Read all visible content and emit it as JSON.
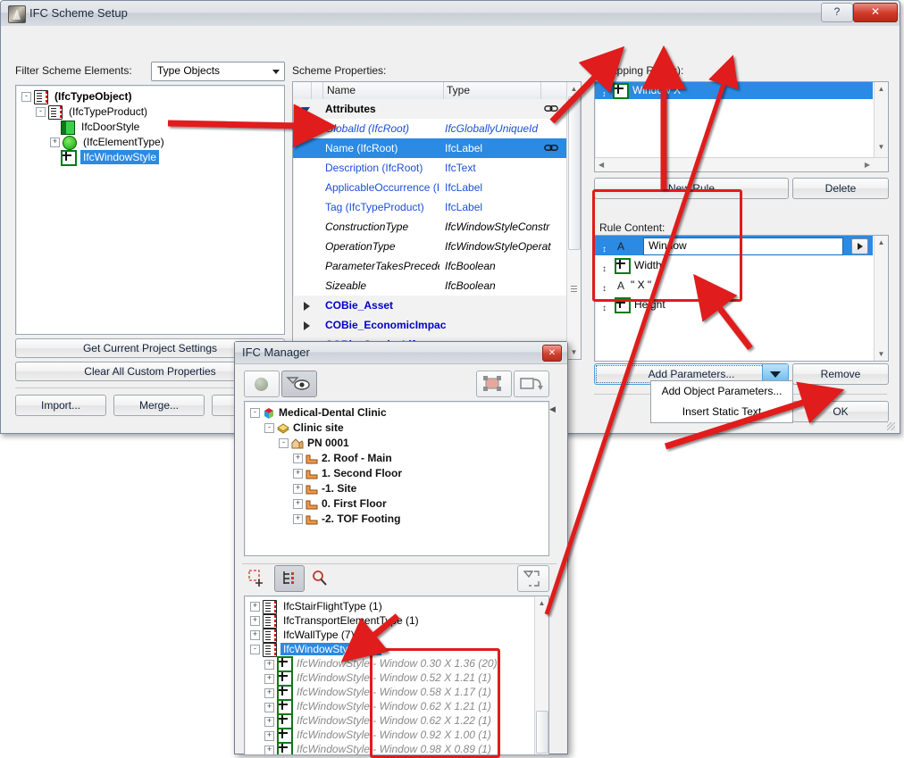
{
  "main_window": {
    "title": "IFC Scheme Setup",
    "help_label": "?",
    "close_label": "✕",
    "filter_label": "Filter Scheme Elements:",
    "filter_value": "Type Objects",
    "scheme_properties_label": "Scheme Properties:",
    "mapping_rules_label": "Mapping Rule(s):",
    "rule_content_label": "Rule Content:"
  },
  "filter_tree": [
    {
      "label": "(IfcTypeObject)",
      "icon": "type-icon",
      "indent": 0,
      "expander": "-",
      "bold": true,
      "selected": false
    },
    {
      "label": "(IfcTypeProduct)",
      "icon": "type-icon",
      "indent": 1,
      "expander": "-",
      "bold": false,
      "selected": false
    },
    {
      "label": "IfcDoorStyle",
      "icon": "door-icon",
      "indent": 2,
      "expander": "",
      "bold": false,
      "selected": false
    },
    {
      "label": "(IfcElementType)",
      "icon": "element-icon",
      "indent": 2,
      "expander": "+",
      "bold": false,
      "selected": false
    },
    {
      "label": "IfcWindowStyle",
      "icon": "window-icon",
      "indent": 2,
      "expander": "",
      "bold": false,
      "selected": true
    }
  ],
  "left_buttons": {
    "get_current": "Get Current Project Settings",
    "clear_all": "Clear All Custom Properties",
    "import": "Import...",
    "merge": "Merge..."
  },
  "scheme_properties": {
    "columns": [
      "Name",
      "Type"
    ],
    "rows": [
      {
        "name": "Attributes",
        "type": "",
        "kind": "group",
        "expanded": true,
        "chain": true
      },
      {
        "name": "GlobalId (IfcRoot)",
        "type": "IfcGloballyUniqueId",
        "kind": "italic-blue",
        "chain": false
      },
      {
        "name": "Name (IfcRoot)",
        "type": "IfcLabel",
        "kind": "selected",
        "chain": true
      },
      {
        "name": "Description (IfcRoot)",
        "type": "IfcText",
        "kind": "blue",
        "chain": false
      },
      {
        "name": "ApplicableOccurrence (Ifc",
        "type": "IfcLabel",
        "kind": "blue",
        "chain": false
      },
      {
        "name": "Tag (IfcTypeProduct)",
        "type": "IfcLabel",
        "kind": "blue",
        "chain": false
      },
      {
        "name": "ConstructionType",
        "type": "IfcWindowStyleConstr",
        "kind": "italic",
        "chain": false
      },
      {
        "name": "OperationType",
        "type": "IfcWindowStyleOperat",
        "kind": "italic",
        "chain": false
      },
      {
        "name": "ParameterTakesPreceden",
        "type": "IfcBoolean",
        "kind": "italic",
        "chain": false
      },
      {
        "name": "Sizeable",
        "type": "IfcBoolean",
        "kind": "italic",
        "chain": false
      },
      {
        "name": "COBie_Asset",
        "type": "",
        "kind": "group-collapsed",
        "chain": false
      },
      {
        "name": "COBie_EconomicImpac",
        "type": "",
        "kind": "group-collapsed",
        "chain": false
      },
      {
        "name": "COBie_ServiceLife",
        "type": "",
        "kind": "group-collapsed",
        "chain": false
      }
    ]
  },
  "mapping_rules": {
    "items": [
      {
        "label": "Window <Width> X <Height>",
        "icon": "window-icon",
        "selected": true
      }
    ],
    "new_rule_label": "New Rule",
    "delete_label": "Delete"
  },
  "rule_content": {
    "items": [
      {
        "label": "Window",
        "icon": "text-icon",
        "selected": true,
        "editable": true
      },
      {
        "label": "Width",
        "icon": "window-icon",
        "selected": false,
        "editable": false
      },
      {
        "label": "\" X \"",
        "icon": "text-icon",
        "selected": false,
        "editable": false
      },
      {
        "label": "Height",
        "icon": "window-icon",
        "selected": false,
        "editable": false
      }
    ],
    "add_parameters_label": "Add Parameters...",
    "remove_label": "Remove",
    "ok_label": "OK",
    "menu_items": [
      "Add Object Parameters...",
      "Insert Static Text"
    ]
  },
  "ifc_manager": {
    "title": "IFC Manager",
    "close_label": "✕",
    "toolbar_top": [
      "sphere-icon",
      "eye-select-icon",
      "select-object-icon",
      "assign-object-icon"
    ],
    "toolbar_bottom": [
      "new-element-icon",
      "tree-view-icon",
      "search-icon",
      "filter-icon"
    ],
    "project_tree": [
      {
        "label": "Medical-Dental Clinic",
        "icon": "project-icon",
        "indent": 0,
        "expander": "-"
      },
      {
        "label": "Clinic site",
        "icon": "site-icon",
        "indent": 1,
        "expander": "-"
      },
      {
        "label": "PN 0001",
        "icon": "building-icon",
        "indent": 2,
        "expander": "-"
      },
      {
        "label": "2. Roof - Main",
        "icon": "storey-icon",
        "indent": 3,
        "expander": "+"
      },
      {
        "label": "1. Second Floor",
        "icon": "storey-icon",
        "indent": 3,
        "expander": "+"
      },
      {
        "label": "-1. Site",
        "icon": "storey-icon",
        "indent": 3,
        "expander": "+"
      },
      {
        "label": "0. First Floor",
        "icon": "storey-icon",
        "indent": 3,
        "expander": "+"
      },
      {
        "label": "-2. TOF Footing",
        "icon": "storey-icon",
        "indent": 3,
        "expander": "+"
      }
    ],
    "type_tree": [
      {
        "label": "IfcStairFlightType (1)",
        "icon": "type-icon",
        "indent": 0,
        "expander": "+",
        "selected": false,
        "value": ""
      },
      {
        "label": "IfcTransportElementType (1)",
        "icon": "type-icon",
        "indent": 0,
        "expander": "+",
        "selected": false,
        "value": ""
      },
      {
        "label": "IfcWallType (7)",
        "icon": "type-icon",
        "indent": 0,
        "expander": "+",
        "selected": false,
        "value": ""
      },
      {
        "label": "IfcWindowStyle (21)",
        "icon": "type-icon",
        "indent": 0,
        "expander": "-",
        "selected": true,
        "value": ""
      },
      {
        "label": "IfcWindowStyle",
        "icon": "window-icon",
        "indent": 1,
        "expander": "+",
        "selected": false,
        "value": "Window 0.30 X 1.36 (20)"
      },
      {
        "label": "IfcWindowStyle",
        "icon": "window-icon",
        "indent": 1,
        "expander": "+",
        "selected": false,
        "value": "Window 0.52 X 1.21 (1)"
      },
      {
        "label": "IfcWindowStyle",
        "icon": "window-icon",
        "indent": 1,
        "expander": "+",
        "selected": false,
        "value": "Window 0.58 X 1.17 (1)"
      },
      {
        "label": "IfcWindowStyle",
        "icon": "window-icon",
        "indent": 1,
        "expander": "+",
        "selected": false,
        "value": "Window 0.62 X 1.21 (1)"
      },
      {
        "label": "IfcWindowStyle",
        "icon": "window-icon",
        "indent": 1,
        "expander": "+",
        "selected": false,
        "value": "Window 0.62 X 1.22 (1)"
      },
      {
        "label": "IfcWindowStyle",
        "icon": "window-icon",
        "indent": 1,
        "expander": "+",
        "selected": false,
        "value": "Window 0.92 X 1.00 (1)"
      },
      {
        "label": "IfcWindowStyle",
        "icon": "window-icon",
        "indent": 1,
        "expander": "+",
        "selected": false,
        "value": "Window 0.98 X 0.89 (1)"
      }
    ]
  },
  "colors": {
    "selection_blue": "#2a8ae4",
    "annotation_red": "#e01b1b",
    "link_blue": "#1d4fd8",
    "group_blue": "#0000cc"
  }
}
